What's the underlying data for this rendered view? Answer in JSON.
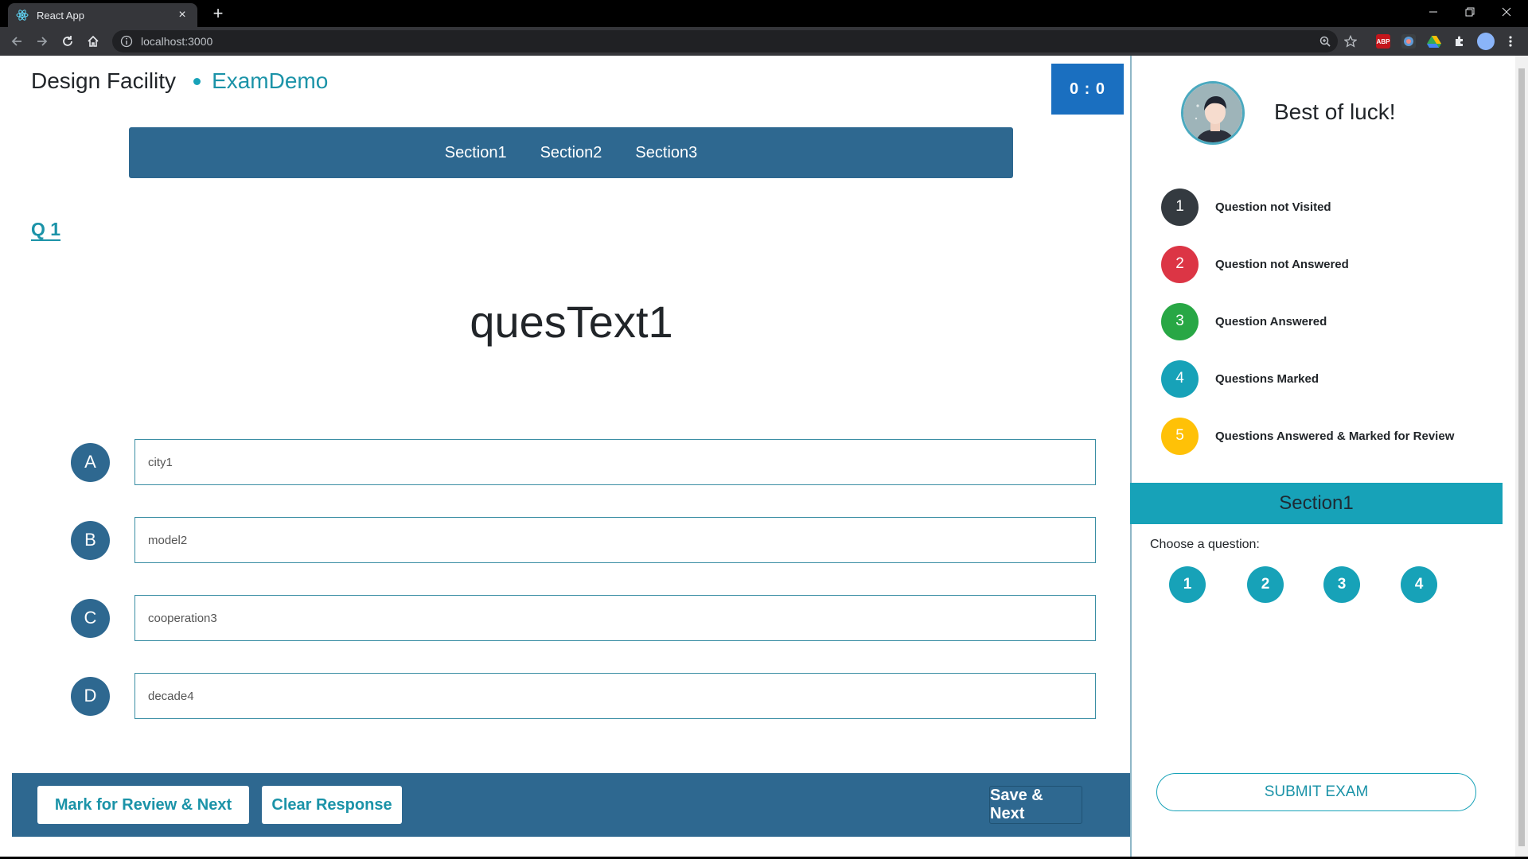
{
  "browser": {
    "tab_title": "React App",
    "tab_close": "×",
    "new_tab": "+",
    "url": "localhost:3000",
    "extensions": [
      "ABP"
    ]
  },
  "app": {
    "brand_main": "Design Facility",
    "brand_sub": "ExamDemo",
    "timer": "0 : 0",
    "sections": [
      "Section1",
      "Section2",
      "Section3"
    ],
    "question_number": "Q 1",
    "question_text": "quesText1",
    "options": [
      {
        "letter": "A",
        "text": "city1"
      },
      {
        "letter": "B",
        "text": "model2"
      },
      {
        "letter": "C",
        "text": "cooperation3"
      },
      {
        "letter": "D",
        "text": "decade4"
      }
    ],
    "buttons": {
      "mark_review": "Mark for Review & Next",
      "clear": "Clear Response",
      "save_next": "Save & Next"
    }
  },
  "sidebar": {
    "greeting": "Best of luck!",
    "legend": [
      {
        "num": "1",
        "label": "Question not Visited",
        "color": "#343a40"
      },
      {
        "num": "2",
        "label": "Question not Answered",
        "color": "#dc3545"
      },
      {
        "num": "3",
        "label": "Question Answered",
        "color": "#28a745"
      },
      {
        "num": "4",
        "label": "Questions Marked",
        "color": "#17a2b8"
      },
      {
        "num": "5",
        "label": "Questions Answered & Marked for Review",
        "color": "#ffc107"
      }
    ],
    "current_section": "Section1",
    "choose_label": "Choose a question:",
    "question_buttons": [
      "1",
      "2",
      "3",
      "4"
    ],
    "submit": "SUBMIT EXAM"
  }
}
